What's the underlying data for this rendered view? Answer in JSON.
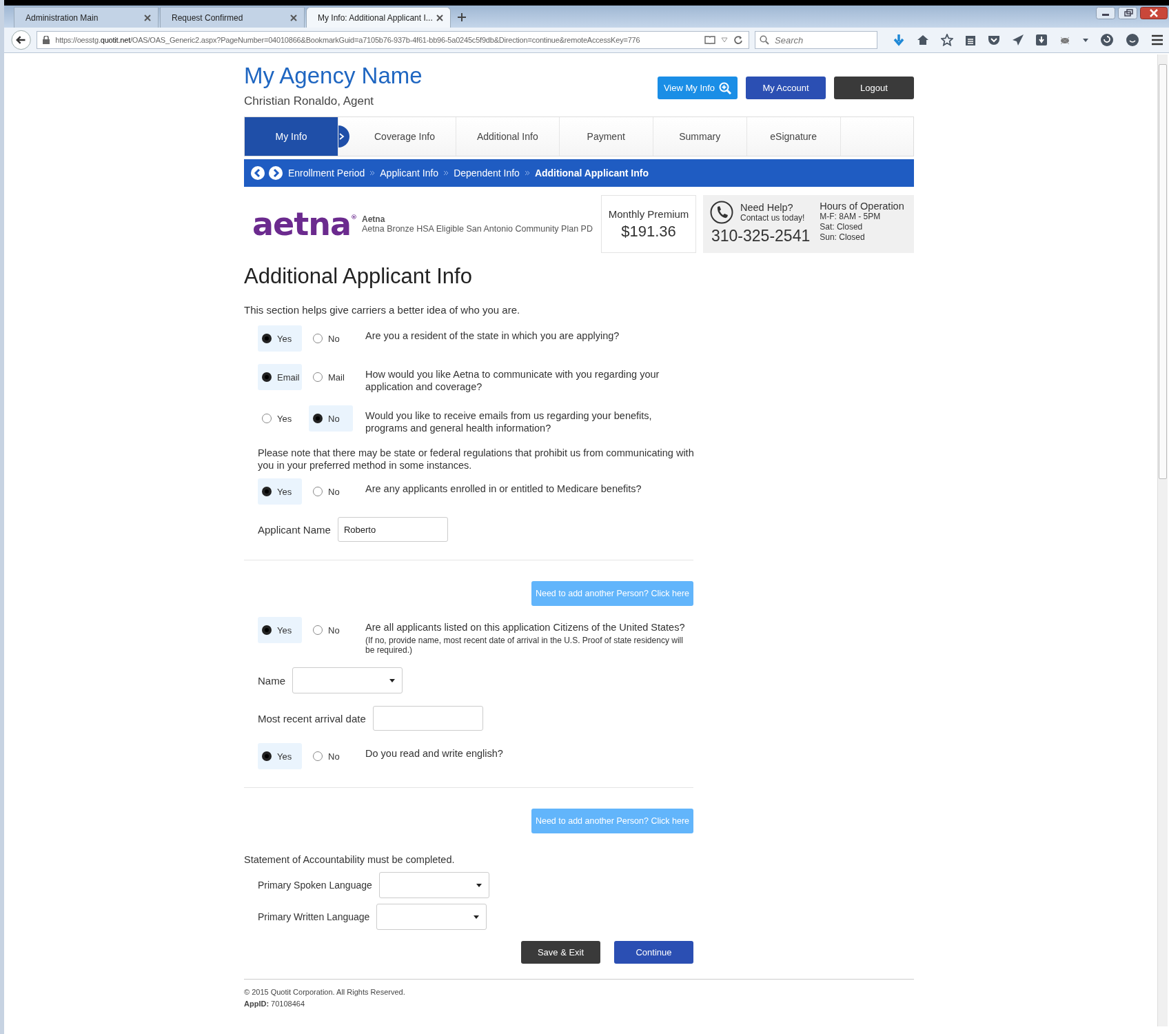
{
  "browser": {
    "tabs": [
      {
        "label": "Administration Main",
        "selected": false
      },
      {
        "label": "Request Confirmed",
        "selected": false
      },
      {
        "label": "My Info: Additional Applicant I...",
        "selected": true
      }
    ],
    "url": "https://oesstg.**quotit.net**/OAS/OAS_Generic2.aspx?PageNumber=04010866&BookmarkGuid=a7105b76-937b-4f61-bb96-5a0245c5f9db&Direction=continue&remoteAccessKey=776",
    "search": {
      "placeholder": "Search"
    }
  },
  "header": {
    "agency_name": "My Agency Name",
    "agent": "Christian Ronaldo, Agent",
    "buttons": [
      {
        "label": "View My Info",
        "kind": "info"
      },
      {
        "label": "My Account",
        "kind": "account"
      },
      {
        "label": "Logout",
        "kind": "logout"
      }
    ]
  },
  "steps": [
    {
      "label": "My Info",
      "selected": true
    },
    {
      "label": "Coverage Info",
      "selected": false
    },
    {
      "label": "Additional Info",
      "selected": false
    },
    {
      "label": "Payment",
      "selected": false
    },
    {
      "label": "Summary",
      "selected": false
    },
    {
      "label": "eSignature",
      "selected": false
    }
  ],
  "breadcrumb": [
    {
      "label": "Enrollment Period",
      "selected": false
    },
    {
      "label": "Applicant Info",
      "selected": false
    },
    {
      "label": "Dependent Info",
      "selected": false
    },
    {
      "label": "Additional Applicant Info",
      "selected": true
    }
  ],
  "plan": {
    "logo": "aetna$^{®}$",
    "carrier": "Aetna",
    "name": "Aetna Bronze HSA Eligible San Antonio Community Plan PD"
  },
  "premium": {
    "label": "Monthly Premium",
    "amount": "$191.36"
  },
  "help": {
    "title": "Need Help?",
    "subtitle": "Contact us today!",
    "phone": "310-325-2541",
    "hours_title": "Hours of Operation",
    "hours": [
      "M-F: 8AM - 5PM",
      "Sat: Closed",
      "Sun: Closed"
    ]
  },
  "page": {
    "title": "Additional Applicant Info",
    "intro": "This section helps give carriers a better idea of who you are."
  },
  "form": [
    {
      "kind": "radio",
      "options": [
        {
          "label": "Yes",
          "selected": true
        },
        {
          "label": "No",
          "selected": false
        }
      ],
      "question": "Are you a resident of the state in which you are applying?"
    },
    {
      "kind": "radio",
      "options": [
        {
          "label": "Email",
          "selected": true
        },
        {
          "label": "Mail",
          "selected": false
        }
      ],
      "question": "How would you like Aetna to communicate with you regarding your application and coverage?"
    },
    {
      "kind": "radio",
      "options": [
        {
          "label": "Yes",
          "selected": false
        },
        {
          "label": "No",
          "selected": true
        }
      ],
      "question": "Would you like to receive emails from us regarding your benefits, programs and general health information?"
    },
    {
      "kind": "notice",
      "text": "Please note that there may be state or federal regulations that prohibit us from communicating with you in your preferred method in some instances."
    },
    {
      "kind": "radio",
      "options": [
        {
          "label": "Yes",
          "selected": true
        },
        {
          "label": "No",
          "selected": false
        }
      ],
      "question": "Are any applicants enrolled in or entitled to Medicare benefits?"
    },
    {
      "kind": "field",
      "label": "Applicant Name",
      "value": "Roberto"
    },
    {
      "kind": "divider"
    },
    {
      "kind": "add-button",
      "label": "Need to add another Person? Click here"
    },
    {
      "kind": "radio",
      "options": [
        {
          "label": "Yes",
          "selected": true
        },
        {
          "label": "No",
          "selected": false
        }
      ],
      "question": "Are all applicants listed on this application Citizens of the United States?",
      "note": "(If no, provide name, most recent date of arrival in the U.S.  Proof of state residency will be required.)"
    },
    {
      "kind": "select",
      "label": "Name"
    },
    {
      "kind": "field",
      "label": "Most recent arrival date"
    },
    {
      "kind": "radio",
      "options": [
        {
          "label": "Yes",
          "selected": true
        },
        {
          "label": "No",
          "selected": false
        }
      ],
      "question": "Do you read and write english?"
    },
    {
      "kind": "divider"
    },
    {
      "kind": "add-button",
      "label": "Need to add another Person? Click here"
    },
    {
      "kind": "statement",
      "text": "Statement of Accountability must be completed."
    },
    {
      "kind": "select",
      "label": "Primary Spoken Language"
    },
    {
      "kind": "select",
      "label": "Primary Written Language"
    }
  ],
  "actions": [
    {
      "label": "Save & Exit",
      "kind": "secondary"
    },
    {
      "label": "Continue",
      "kind": "primary"
    }
  ],
  "footer": {
    "copyright": "© 2015 Quotit Corporation. All Rights Reserved.",
    "app_id": "**AppID:** 70108464"
  }
}
